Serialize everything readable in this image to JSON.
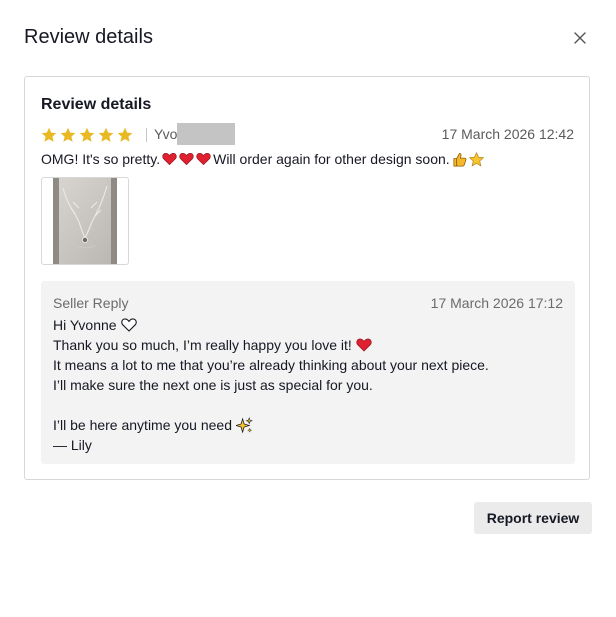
{
  "modal": {
    "title": "Review details",
    "close_icon": "close-icon"
  },
  "review": {
    "section_title": "Review details",
    "rating": 5,
    "rating_max": 5,
    "reviewer_name_visible": "Yvo",
    "date": "17 March 2026 12:42",
    "text_start": "OMG! It's so pretty.",
    "text_end": "Will order again for other design soon.",
    "emoji_after_start": [
      "red-heart-icon",
      "red-heart-icon",
      "red-heart-icon"
    ],
    "emoji_after_end": [
      "thumbs-up-icon",
      "star-icon"
    ],
    "photo": "necklace-photo-thumbnail"
  },
  "seller_reply": {
    "label": "Seller Reply",
    "date": "17 March 2026 17:12",
    "lines": [
      "Hi Yvonne",
      "Thank you so much, I’m really happy you love it!",
      "It means a lot to me that you’re already thinking about your next piece.",
      "I’ll make sure the next one is just as special for you.",
      "",
      "I’ll be here anytime you need",
      "— Lily"
    ]
  },
  "actions": {
    "report_label": "Report review"
  },
  "colors": {
    "star": "#e8b923",
    "heart": "#e0202f",
    "reply_bg": "#f3f3f3",
    "button_bg": "#ebebeb"
  }
}
